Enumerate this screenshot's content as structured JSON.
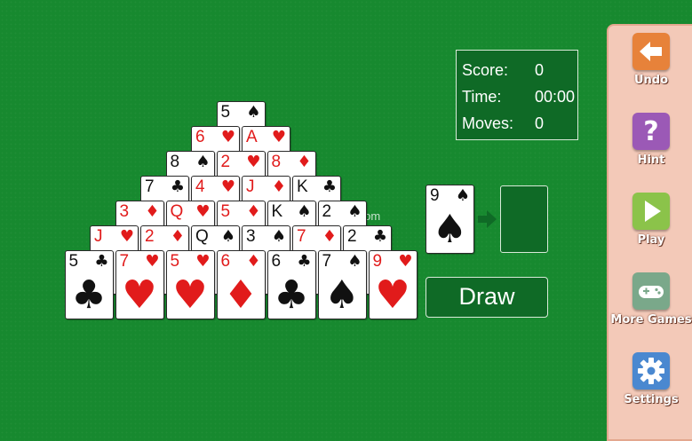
{
  "stats": {
    "score_label": "Score:",
    "score_value": "0",
    "time_label": "Time:",
    "time_value": "00:00",
    "moves_label": "Moves:",
    "moves_value": "0"
  },
  "pyramid": [
    [
      {
        "rank": "5",
        "suit": "♠",
        "color": "black"
      }
    ],
    [
      {
        "rank": "6",
        "suit": "♥",
        "color": "red"
      },
      {
        "rank": "A",
        "suit": "♥",
        "color": "red"
      }
    ],
    [
      {
        "rank": "8",
        "suit": "♠",
        "color": "black"
      },
      {
        "rank": "2",
        "suit": "♥",
        "color": "red"
      },
      {
        "rank": "8",
        "suit": "♦",
        "color": "red"
      }
    ],
    [
      {
        "rank": "7",
        "suit": "♣",
        "color": "black"
      },
      {
        "rank": "4",
        "suit": "♥",
        "color": "red"
      },
      {
        "rank": "J",
        "suit": "♦",
        "color": "red"
      },
      {
        "rank": "K",
        "suit": "♣",
        "color": "black"
      }
    ],
    [
      {
        "rank": "3",
        "suit": "♦",
        "color": "red"
      },
      {
        "rank": "Q",
        "suit": "♥",
        "color": "red"
      },
      {
        "rank": "5",
        "suit": "♦",
        "color": "red"
      },
      {
        "rank": "K",
        "suit": "♠",
        "color": "black"
      },
      {
        "rank": "2",
        "suit": "♠",
        "color": "black"
      }
    ],
    [
      {
        "rank": "J",
        "suit": "♥",
        "color": "red"
      },
      {
        "rank": "2",
        "suit": "♦",
        "color": "red"
      },
      {
        "rank": "Q",
        "suit": "♠",
        "color": "black"
      },
      {
        "rank": "3",
        "suit": "♠",
        "color": "black"
      },
      {
        "rank": "7",
        "suit": "♦",
        "color": "red"
      },
      {
        "rank": "2",
        "suit": "♣",
        "color": "black"
      }
    ],
    [
      {
        "rank": "5",
        "suit": "♣",
        "color": "black"
      },
      {
        "rank": "7",
        "suit": "♥",
        "color": "red"
      },
      {
        "rank": "5",
        "suit": "♥",
        "color": "red"
      },
      {
        "rank": "6",
        "suit": "♦",
        "color": "red"
      },
      {
        "rank": "6",
        "suit": "♣",
        "color": "black"
      },
      {
        "rank": "7",
        "suit": "♠",
        "color": "black"
      },
      {
        "rank": "9",
        "suit": "♥",
        "color": "red"
      }
    ]
  ],
  "stock_card": {
    "rank": "9",
    "suit": "♠",
    "color": "black"
  },
  "draw_label": "Draw",
  "watermark": "UpdateStar.com",
  "sidebar": {
    "undo": {
      "label": "Undo",
      "color": "#e7823a",
      "icon": "left-arrow-icon"
    },
    "hint": {
      "label": "Hint",
      "color": "#9b59b6",
      "icon": "question-icon",
      "glyph": "?"
    },
    "play": {
      "label": "Play",
      "color": "#8bc34a",
      "icon": "play-icon"
    },
    "more_games": {
      "label": "More Games",
      "color": "#7aa88a",
      "icon": "gamepad-icon"
    },
    "settings": {
      "label": "Settings",
      "color": "#4a88d0",
      "icon": "gear-icon"
    }
  },
  "colors": {
    "felt": "#17892f",
    "panel": "#0f6a26",
    "red": "#e11b1b",
    "black": "#111111"
  }
}
